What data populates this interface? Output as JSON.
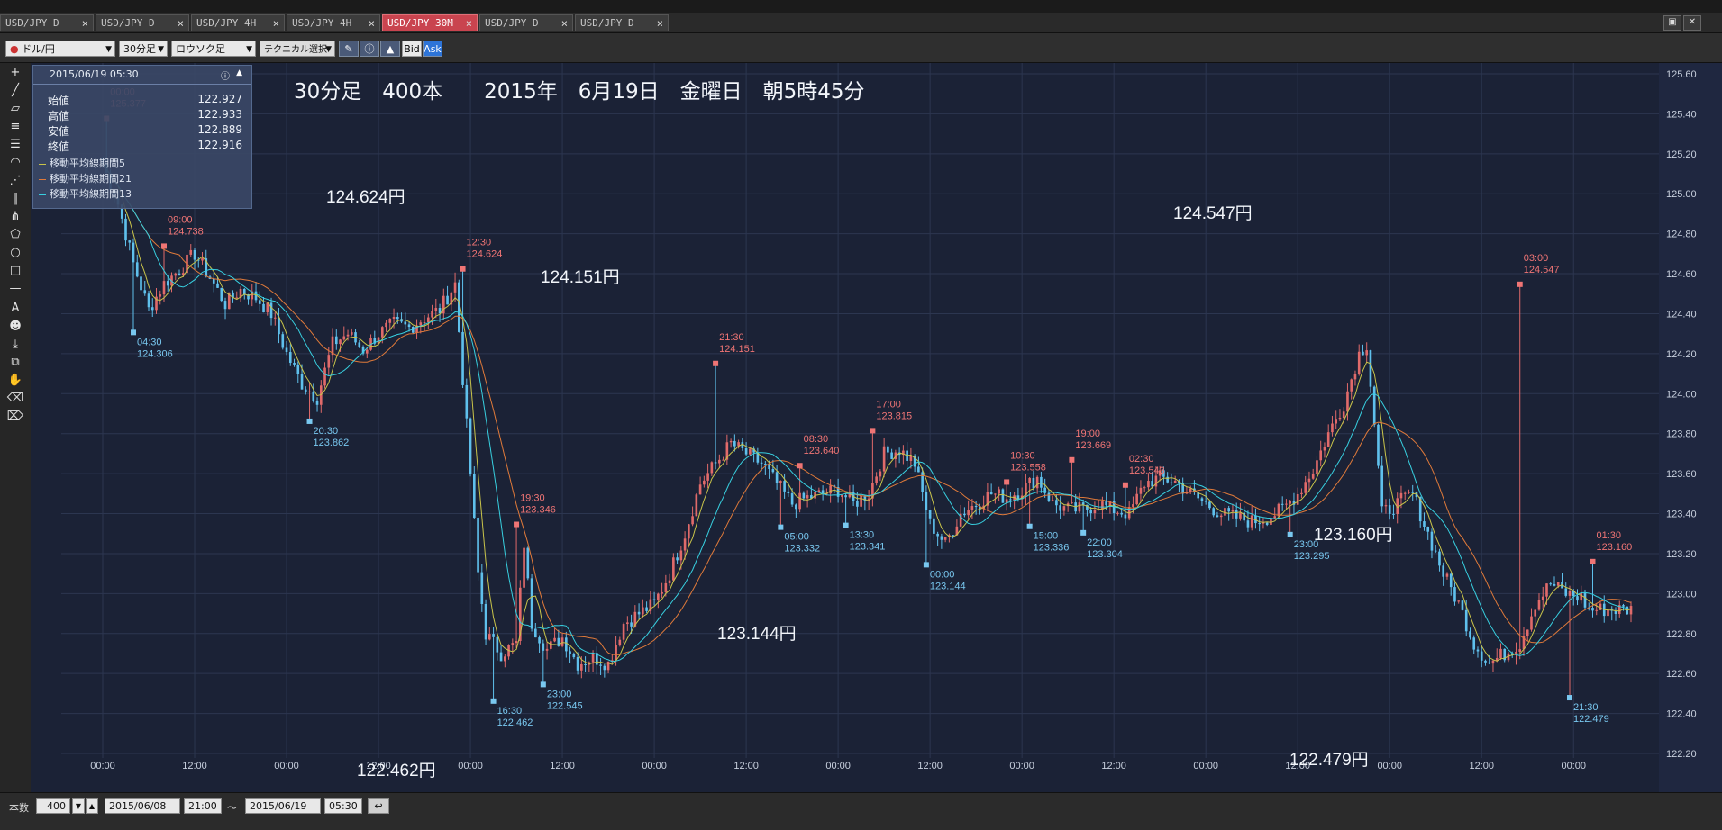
{
  "tabs": [
    {
      "label": "USD/JPY D",
      "active": false
    },
    {
      "label": "USD/JPY D",
      "active": false
    },
    {
      "label": "USD/JPY 4H",
      "active": false
    },
    {
      "label": "USD/JPY 4H",
      "active": false
    },
    {
      "label": "USD/JPY 30M",
      "active": true
    },
    {
      "label": "USD/JPY D",
      "active": false
    },
    {
      "label": "USD/JPY D",
      "active": false
    }
  ],
  "tab_close": "×",
  "toolbar": {
    "currency": "ドル/円",
    "timeframe": "30分足",
    "chart_type": "ロウソク足",
    "technical": "テクニカル選択",
    "bid": "Bid",
    "ask": "Ask"
  },
  "info": {
    "datetime": "2015/06/19 05:30",
    "rows": [
      {
        "label": "始値",
        "value": "122.927"
      },
      {
        "label": "高値",
        "value": "122.933"
      },
      {
        "label": "安値",
        "value": "122.889"
      },
      {
        "label": "終値",
        "value": "122.916"
      }
    ],
    "ma": [
      {
        "label": "移動平均線期間5",
        "color": "#c9c44a"
      },
      {
        "label": "移動平均線期間21",
        "color": "#e07a3a"
      },
      {
        "label": "移動平均線期間13",
        "color": "#38d0e0"
      }
    ]
  },
  "overlay_title": "30分足　400本　　2015年　6月19日　金曜日　朝5時45分",
  "price_callouts": [
    "124.624円",
    "124.151円",
    "122.462円",
    "123.144円",
    "124.547円",
    "123.160円",
    "122.479円"
  ],
  "bottom": {
    "count_label": "本数",
    "count": "400",
    "from_date": "2015/06/08",
    "from_time": "21:00",
    "tilde": "～",
    "to_date": "2015/06/19",
    "to_time": "05:30"
  },
  "colors": {
    "bg": "#1b2236",
    "grid": "#2c3650",
    "up": "#e06a6a",
    "down": "#5fc0ec",
    "hi_label": "#f07575",
    "lo_label": "#79c8f0"
  },
  "chart_data": {
    "type": "candlestick",
    "ylim": [
      122.2,
      125.6
    ],
    "y_ticks": [
      "125.60",
      "125.40",
      "125.20",
      "125.00",
      "124.80",
      "124.60",
      "124.40",
      "124.20",
      "124.00",
      "123.80",
      "123.60",
      "123.40",
      "123.20",
      "123.00",
      "122.80",
      "122.60",
      "122.40",
      "122.20"
    ],
    "x_tick_labels": [
      "00:00",
      "12:00",
      "00:00",
      "12:00",
      "00:00",
      "12:00",
      "00:00",
      "12:00",
      "00:00",
      "12:00",
      "00:00",
      "12:00",
      "00:00",
      "12:00",
      "00:00",
      "12:00",
      "00:00"
    ],
    "bars_total": 400,
    "price_path": [
      [
        0,
        125.15
      ],
      [
        4,
        124.95
      ],
      [
        8,
        124.65
      ],
      [
        12,
        124.42
      ],
      [
        16,
        124.55
      ],
      [
        20,
        124.62
      ],
      [
        24,
        124.7
      ],
      [
        28,
        124.58
      ],
      [
        32,
        124.45
      ],
      [
        36,
        124.52
      ],
      [
        40,
        124.48
      ],
      [
        44,
        124.4
      ],
      [
        48,
        124.2
      ],
      [
        52,
        124.05
      ],
      [
        56,
        123.98
      ],
      [
        60,
        124.25
      ],
      [
        64,
        124.3
      ],
      [
        68,
        124.22
      ],
      [
        72,
        124.3
      ],
      [
        76,
        124.35
      ],
      [
        80,
        124.33
      ],
      [
        84,
        124.38
      ],
      [
        88,
        124.42
      ],
      [
        92,
        124.55
      ],
      [
        96,
        123.6
      ],
      [
        98,
        123.1
      ],
      [
        100,
        122.8
      ],
      [
        104,
        122.7
      ],
      [
        108,
        122.75
      ],
      [
        110,
        123.25
      ],
      [
        112,
        122.85
      ],
      [
        116,
        122.72
      ],
      [
        120,
        122.78
      ],
      [
        124,
        122.65
      ],
      [
        128,
        122.68
      ],
      [
        132,
        122.65
      ],
      [
        136,
        122.85
      ],
      [
        140,
        122.9
      ],
      [
        144,
        122.95
      ],
      [
        148,
        123.1
      ],
      [
        152,
        123.3
      ],
      [
        156,
        123.55
      ],
      [
        160,
        123.65
      ],
      [
        164,
        123.75
      ],
      [
        168,
        123.7
      ],
      [
        172,
        123.65
      ],
      [
        176,
        123.55
      ],
      [
        180,
        123.45
      ],
      [
        184,
        123.48
      ],
      [
        188,
        123.5
      ],
      [
        192,
        123.52
      ],
      [
        196,
        123.45
      ],
      [
        200,
        123.5
      ],
      [
        204,
        123.7
      ],
      [
        208,
        123.72
      ],
      [
        212,
        123.65
      ],
      [
        216,
        123.35
      ],
      [
        220,
        123.25
      ],
      [
        224,
        123.4
      ],
      [
        228,
        123.45
      ],
      [
        232,
        123.5
      ],
      [
        236,
        123.48
      ],
      [
        240,
        123.52
      ],
      [
        244,
        123.58
      ],
      [
        248,
        123.45
      ],
      [
        252,
        123.42
      ],
      [
        256,
        123.42
      ],
      [
        260,
        123.45
      ],
      [
        264,
        123.42
      ],
      [
        268,
        123.4
      ],
      [
        272,
        123.55
      ],
      [
        276,
        123.58
      ],
      [
        280,
        123.56
      ],
      [
        284,
        123.5
      ],
      [
        288,
        123.45
      ],
      [
        292,
        123.4
      ],
      [
        296,
        123.38
      ],
      [
        300,
        123.36
      ],
      [
        304,
        123.38
      ],
      [
        308,
        123.42
      ],
      [
        312,
        123.5
      ],
      [
        316,
        123.62
      ],
      [
        320,
        123.8
      ],
      [
        324,
        123.95
      ],
      [
        328,
        124.2
      ],
      [
        330,
        124.25
      ],
      [
        332,
        123.85
      ],
      [
        334,
        123.4
      ],
      [
        338,
        123.45
      ],
      [
        342,
        123.5
      ],
      [
        346,
        123.3
      ],
      [
        350,
        123.1
      ],
      [
        354,
        122.95
      ],
      [
        358,
        122.75
      ],
      [
        362,
        122.65
      ],
      [
        366,
        122.7
      ],
      [
        370,
        122.75
      ],
      [
        374,
        122.95
      ],
      [
        378,
        123.05
      ],
      [
        382,
        123.0
      ],
      [
        386,
        122.98
      ],
      [
        388,
        122.92
      ]
    ],
    "annotations": [
      {
        "bar": 1,
        "time": "00:00",
        "price": "125.377",
        "type": "high"
      },
      {
        "bar": 16,
        "time": "09:00",
        "price": "124.738",
        "type": "high"
      },
      {
        "bar": 8,
        "time": "04:30",
        "price": "124.306",
        "type": "low"
      },
      {
        "bar": 54,
        "time": "20:30",
        "price": "123.862",
        "type": "low"
      },
      {
        "bar": 94,
        "time": "12:30",
        "price": "124.624",
        "type": "high"
      },
      {
        "bar": 108,
        "time": "19:30",
        "price": "123.346",
        "type": "high"
      },
      {
        "bar": 102,
        "time": "16:30",
        "price": "122.462",
        "type": "low"
      },
      {
        "bar": 115,
        "time": "23:00",
        "price": "122.545",
        "type": "low"
      },
      {
        "bar": 160,
        "time": "21:30",
        "price": "124.151",
        "type": "high"
      },
      {
        "bar": 182,
        "time": "08:30",
        "price": "123.640",
        "type": "high"
      },
      {
        "bar": 177,
        "time": "05:00",
        "price": "123.332",
        "type": "low"
      },
      {
        "bar": 194,
        "time": "13:30",
        "price": "123.341",
        "type": "low"
      },
      {
        "bar": 201,
        "time": "17:00",
        "price": "123.815",
        "type": "high"
      },
      {
        "bar": 215,
        "time": "00:00",
        "price": "123.144",
        "type": "low"
      },
      {
        "bar": 236,
        "time": "10:30",
        "price": "123.558",
        "type": "high"
      },
      {
        "bar": 253,
        "time": "19:00",
        "price": "123.669",
        "type": "high"
      },
      {
        "bar": 242,
        "time": "15:00",
        "price": "123.336",
        "type": "low"
      },
      {
        "bar": 256,
        "time": "22:00",
        "price": "123.304",
        "type": "low"
      },
      {
        "bar": 267,
        "time": "02:30",
        "price": "123.543",
        "type": "high"
      },
      {
        "bar": 310,
        "time": "23:00",
        "price": "123.295",
        "type": "low"
      },
      {
        "bar": 370,
        "time": "03:00",
        "price": "124.547",
        "type": "high"
      },
      {
        "bar": 383,
        "time": "21:30",
        "price": "122.479",
        "type": "low"
      },
      {
        "bar": 389,
        "time": "01:30",
        "price": "123.160",
        "type": "high"
      }
    ]
  }
}
